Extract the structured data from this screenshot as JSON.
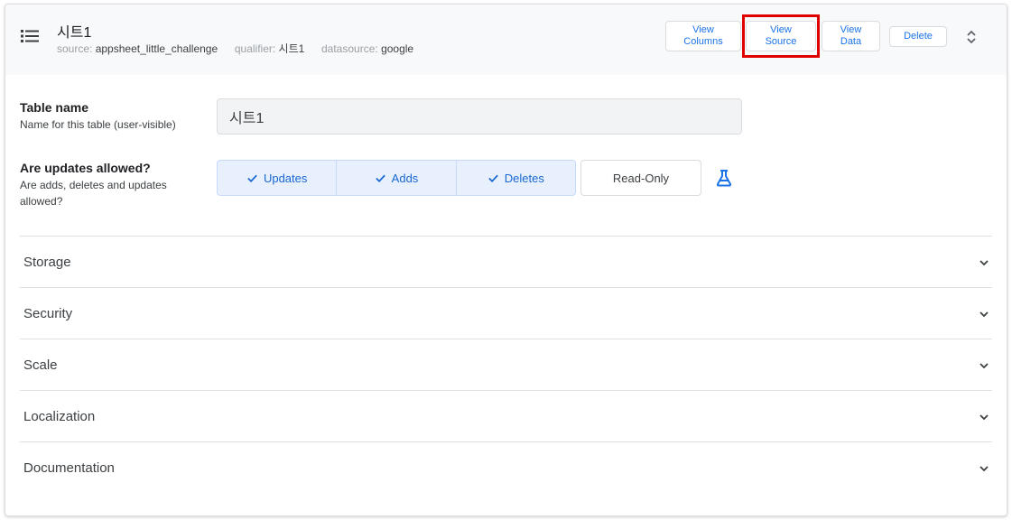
{
  "header": {
    "icon": "list-icon",
    "table_title": "시트1",
    "meta": {
      "source_label": "source:",
      "source_value": "appsheet_little_challenge",
      "qualifier_label": "qualifier:",
      "qualifier_value": "시트1",
      "datasource_label": "datasource:",
      "datasource_value": "google"
    },
    "buttons": {
      "view_columns": [
        "View",
        "Columns"
      ],
      "view_source": [
        "View",
        "Source"
      ],
      "view_data": [
        "View",
        "Data"
      ],
      "delete": "Delete"
    },
    "highlight_color": "#e00000"
  },
  "fields": {
    "table_name": {
      "label": "Table name",
      "description": "Name for this table (user-visible)",
      "value": "시트1"
    },
    "updates": {
      "label": "Are updates allowed?",
      "description": "Are adds, deletes and updates allowed?",
      "options": [
        "Updates",
        "Adds",
        "Deletes"
      ],
      "selected": [
        "Updates",
        "Adds",
        "Deletes"
      ],
      "read_only_label": "Read-Only",
      "icon": "flask-icon"
    }
  },
  "sections": [
    "Storage",
    "Security",
    "Scale",
    "Localization",
    "Documentation"
  ],
  "colors": {
    "accent": "#1a73e8",
    "header_bg": "#f8f9fa",
    "segment_bg": "#e8f0fe"
  }
}
